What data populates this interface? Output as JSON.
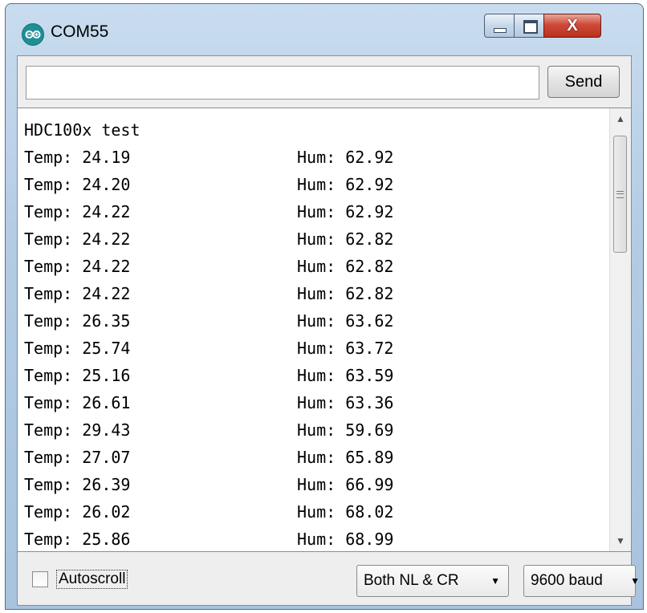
{
  "window": {
    "title": "COM55",
    "close_glyph": "X"
  },
  "input": {
    "value": "",
    "send_label": "Send"
  },
  "output": {
    "header": "HDC100x test",
    "lines": [
      {
        "temp": "Temp: 24.19",
        "hum": "Hum: 62.92"
      },
      {
        "temp": "Temp: 24.20",
        "hum": "Hum: 62.92"
      },
      {
        "temp": "Temp: 24.22",
        "hum": "Hum: 62.92"
      },
      {
        "temp": "Temp: 24.22",
        "hum": "Hum: 62.82"
      },
      {
        "temp": "Temp: 24.22",
        "hum": "Hum: 62.82"
      },
      {
        "temp": "Temp: 24.22",
        "hum": "Hum: 62.82"
      },
      {
        "temp": "Temp: 26.35",
        "hum": "Hum: 63.62"
      },
      {
        "temp": "Temp: 25.74",
        "hum": "Hum: 63.72"
      },
      {
        "temp": "Temp: 25.16",
        "hum": "Hum: 63.59"
      },
      {
        "temp": "Temp: 26.61",
        "hum": "Hum: 63.36"
      },
      {
        "temp": "Temp: 29.43",
        "hum": "Hum: 59.69"
      },
      {
        "temp": "Temp: 27.07",
        "hum": "Hum: 65.89"
      },
      {
        "temp": "Temp: 26.39",
        "hum": "Hum: 66.99"
      },
      {
        "temp": "Temp: 26.02",
        "hum": "Hum: 68.02"
      },
      {
        "temp": "Temp: 25.86",
        "hum": "Hum: 68.99"
      }
    ]
  },
  "footer": {
    "autoscroll_label": "Autoscroll",
    "autoscroll_checked": false,
    "line_ending": "Both NL & CR",
    "baud": "9600 baud"
  },
  "icons": {
    "app": "arduino-icon",
    "minimize": "minimize-icon",
    "maximize": "maximize-icon",
    "close": "close-icon",
    "scroll_up": "scroll-up-arrow-icon",
    "scroll_down": "scroll-down-arrow-icon",
    "dropdown": "chevron-down-icon"
  }
}
